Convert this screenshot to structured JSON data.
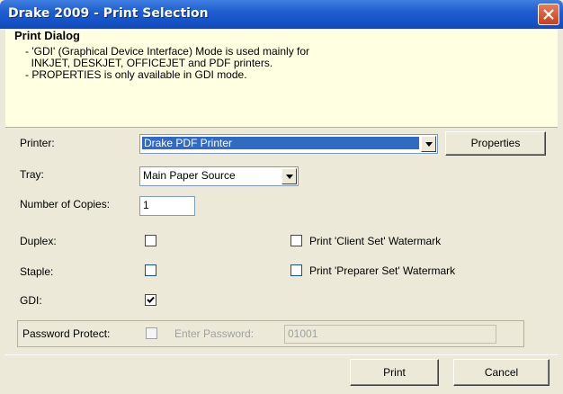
{
  "window": {
    "title": "Drake 2009 - Print Selection"
  },
  "header": {
    "title": "Print Dialog",
    "lines": [
      "- 'GDI' (Graphical Device Interface) Mode is used mainly for",
      "  INKJET, DESKJET, OFFICEJET and PDF printers.",
      "- PROPERTIES is only available in GDI mode."
    ]
  },
  "printer": {
    "label": "Printer:",
    "value": "Drake PDF Printer",
    "properties_label": "Properties"
  },
  "tray": {
    "label": "Tray:",
    "value": "Main Paper Source"
  },
  "copies": {
    "label": "Number of Copies:",
    "value": "1"
  },
  "duplex": {
    "label": "Duplex:",
    "checked": false
  },
  "staple": {
    "label": "Staple:",
    "checked": false
  },
  "gdi": {
    "label": "GDI:",
    "checked": true
  },
  "watermarks": {
    "client_label": "Print 'Client Set' Watermark",
    "client_checked": false,
    "preparer_label": "Print 'Preparer Set' Watermark",
    "preparer_checked": false
  },
  "password": {
    "protect_label": "Password Protect:",
    "enter_label": "Enter Password:",
    "value": "01001"
  },
  "buttons": {
    "print": "Print",
    "cancel": "Cancel"
  }
}
